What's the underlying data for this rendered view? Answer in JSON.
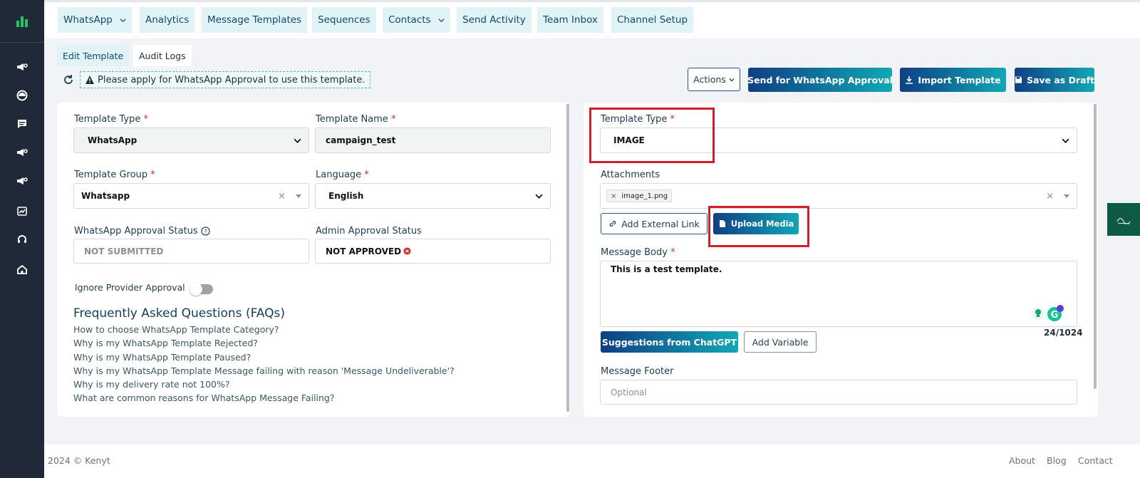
{
  "nav": {
    "items": [
      {
        "label": "WhatsApp",
        "dropdown": true
      },
      {
        "label": "Analytics",
        "dropdown": false
      },
      {
        "label": "Message Templates",
        "dropdown": false
      },
      {
        "label": "Sequences",
        "dropdown": false
      },
      {
        "label": "Contacts",
        "dropdown": true
      },
      {
        "label": "Send Activity",
        "dropdown": false
      },
      {
        "label": "Team Inbox",
        "dropdown": false
      },
      {
        "label": "Channel Setup",
        "dropdown": false
      }
    ]
  },
  "subtabs": {
    "edit": "Edit Template",
    "audit": "Audit Logs"
  },
  "alert": {
    "text": "Please apply for WhatsApp Approval to use this template."
  },
  "actions": {
    "actions_label": "Actions",
    "send_approval": "Send for WhatsApp Approval",
    "import": "Import Template",
    "save_draft": "Save as Draft"
  },
  "left": {
    "template_type": {
      "label": "Template Type",
      "required": "*",
      "value": "WhatsApp"
    },
    "template_name": {
      "label": "Template Name",
      "required": "*",
      "value": "campaign_test"
    },
    "template_group": {
      "label": "Template Group",
      "required": "*",
      "value": "Whatsapp",
      "clear": "×"
    },
    "language": {
      "label": "Language",
      "required": "*",
      "value": "English"
    },
    "wa_status": {
      "label": "WhatsApp Approval Status",
      "value": "NOT SUBMITTED"
    },
    "admin_status": {
      "label": "Admin Approval Status",
      "value": "NOT APPROVED"
    },
    "ignore_provider": {
      "label": "Ignore Provider Approval",
      "enabled": false
    },
    "faq": {
      "title": "Frequently Asked Questions (FAQs)",
      "items": [
        "How to choose WhatsApp Template Category?",
        "Why is my WhatsApp Template Rejected?",
        "Why is my WhatsApp Template Paused?",
        "Why is my WhatsApp Template Message failing with reason 'Message Undeliverable'?",
        "Why is my delivery rate not 100%?",
        "What are common reasons for WhatsApp Message Failing?"
      ]
    }
  },
  "right": {
    "template_type": {
      "label": "Template Type",
      "required": "*",
      "value": "IMAGE"
    },
    "attachments": {
      "label": "Attachments",
      "chip": "image_1.png",
      "chip_x": "×",
      "clear": "×"
    },
    "add_link": "Add External Link",
    "upload": "Upload Media",
    "message_body": {
      "label": "Message Body",
      "required": "*",
      "value": "This is a test template.",
      "counter": "24/1024"
    },
    "grammarly_badge": "1",
    "suggestions": "Suggestions from ChatGPT",
    "add_variable": "Add Variable",
    "footer": {
      "label": "Message Footer",
      "placeholder": "Optional"
    }
  },
  "footer": {
    "copyright": "2024 © Kenyt",
    "about": "About",
    "blog": "Blog",
    "contact": "Contact"
  },
  "colors": {
    "accent": "#0f3f83",
    "teal": "#12a7b5",
    "highlight": "#d01f2b",
    "sidebar": "#1f2937"
  }
}
